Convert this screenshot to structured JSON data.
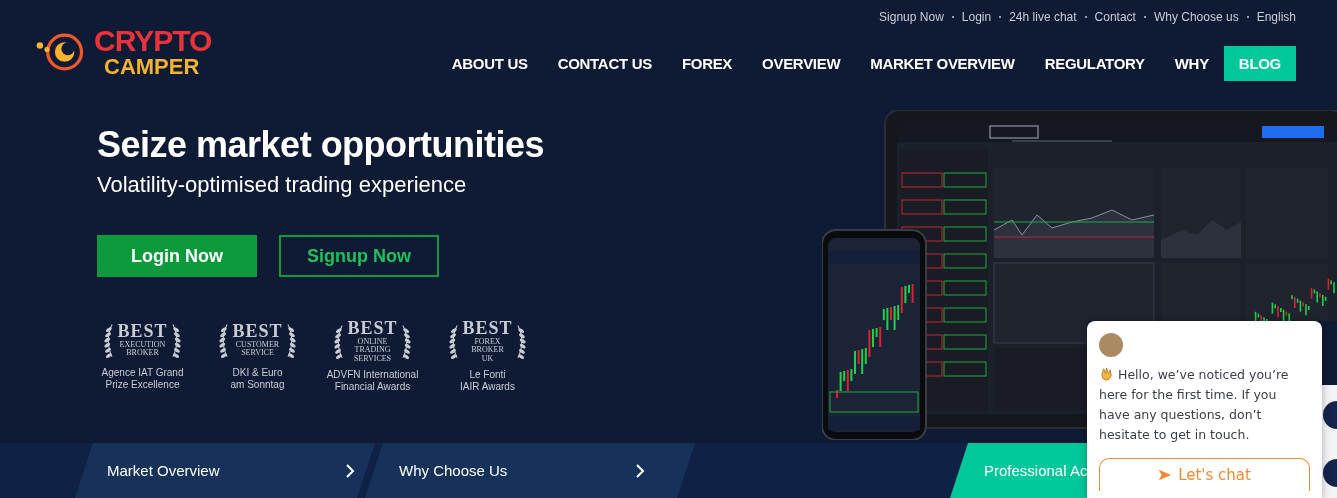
{
  "top_links": [
    "Signup Now",
    "Login",
    "24h live chat",
    "Contact",
    "Why Choose us",
    "English"
  ],
  "logo": {
    "line_1": "CRYPTO",
    "line_2": "CAMPER"
  },
  "nav": [
    {
      "label": "ABOUT US",
      "selected": false
    },
    {
      "label": "CONTACT US",
      "selected": false
    },
    {
      "label": "FOREX",
      "selected": false
    },
    {
      "label": "OVERVIEW",
      "selected": false
    },
    {
      "label": "MARKET OVERVIEW",
      "selected": false
    },
    {
      "label": "REGULATORY",
      "selected": false
    },
    {
      "label": "WHY",
      "selected": false
    },
    {
      "label": "BLOG",
      "selected": true
    }
  ],
  "hero": {
    "title": "Seize market opportunities",
    "subtitle": "Volatility-optimised trading experience",
    "buttons": [
      {
        "label": "Login Now",
        "kind": "filled"
      },
      {
        "label": "Signup Now",
        "kind": "outline"
      }
    ]
  },
  "awards": [
    {
      "badge_lines": [
        "BEST",
        "EXECUTION",
        "BROKER"
      ],
      "caption": [
        "Agence IAT Grand",
        "Prize Excellence"
      ]
    },
    {
      "badge_lines": [
        "BEST",
        "CUSTOMER",
        "SERVICE"
      ],
      "caption": [
        "DKI & Euro",
        "am Sonntag"
      ]
    },
    {
      "badge_lines": [
        "BEST",
        "ONLINE",
        "TRADING",
        "SERVICES"
      ],
      "caption": [
        "ADVFN International",
        "Financial Awards"
      ]
    },
    {
      "badge_lines": [
        "BEST",
        "FOREX",
        "BROKER",
        "UK"
      ],
      "caption": [
        "Le Fonti",
        "IAIR Awards"
      ]
    }
  ],
  "bottom_bar": [
    {
      "label": "Market Overview",
      "kind": "link"
    },
    {
      "label": "Why Choose Us",
      "kind": "link"
    },
    {
      "label": "Professional Ac",
      "kind": "highlight"
    }
  ],
  "chat": {
    "message": "Hello, we’ve noticed you’re here for the first time. If you have any questions, don’t hesitate to get in touch.",
    "button": "Let's chat"
  }
}
